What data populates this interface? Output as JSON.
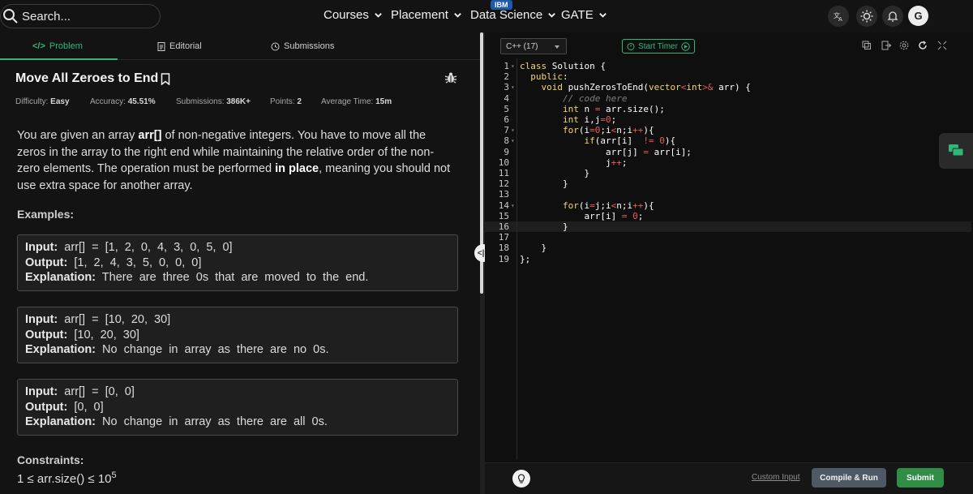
{
  "topbar": {
    "search_placeholder": "Search...",
    "nav": [
      {
        "label": "Courses"
      },
      {
        "label": "Placement"
      },
      {
        "label": "Data Science",
        "badge": "IBM"
      },
      {
        "label": "GATE"
      }
    ],
    "avatar_initial": "G"
  },
  "tabs": [
    {
      "label": "Problem",
      "icon": "code-icon",
      "active": true
    },
    {
      "label": "Editorial",
      "icon": "document-icon"
    },
    {
      "label": "Submissions",
      "icon": "clock-icon"
    }
  ],
  "problem": {
    "title": "Move All Zeroes to End",
    "difficulty_label": "Difficulty:",
    "difficulty": "Easy",
    "accuracy_label": "Accuracy:",
    "accuracy": "45.51%",
    "submissions_label": "Submissions:",
    "submissions": "386K+",
    "points_label": "Points:",
    "points": "2",
    "avg_time_label": "Average Time:",
    "avg_time": "15m",
    "desc_1": "You are given an array ",
    "desc_arr": "arr[]",
    "desc_2": " of non-negative integers. You have to move all the zeros in the array to the right end while maintaining the relative order of the non-zero elements. The operation must be performed ",
    "desc_inplace": "in place",
    "desc_3": ", meaning you should not use extra space for another array.",
    "examples_heading": "Examples:",
    "examples": [
      {
        "input_label": "Input:",
        "input": "arr[] = [1, 2, 0, 4, 3, 0, 5, 0]",
        "output_label": "Output:",
        "output": "[1, 2, 4, 3, 5, 0, 0, 0]",
        "expl_label": "Explanation:",
        "explanation": "There are three 0s that are moved to the end."
      },
      {
        "input_label": "Input:",
        "input": "arr[] = [10, 20, 30]",
        "output_label": "Output:",
        "output": "[10, 20, 30]",
        "expl_label": "Explanation:",
        "explanation": "No change in array as there are no 0s."
      },
      {
        "input_label": "Input:",
        "input": "arr[] = [0, 0]",
        "output_label": "Output:",
        "output": "[0, 0]",
        "expl_label": "Explanation:",
        "explanation": "No change in array as there are all 0s."
      }
    ],
    "constraints_heading": "Constraints:",
    "constraint_1": "1 ≤ arr.size() ≤ 10",
    "constraint_1_exp": "5"
  },
  "editor": {
    "language": "C++ (17)",
    "timer_label": "Start Timer",
    "active_line": 16,
    "lines": [
      "class Solution {",
      "  public:",
      "    void pushZerosToEnd(vector<int>& arr) {",
      "        // code here",
      "        int n = arr.size();",
      "        int i,j=0;",
      "        for(i=0;i<n;i++){",
      "            if(arr[i]  != 0){",
      "                arr[j] = arr[i];",
      "                j++;",
      "            }",
      "        }",
      "",
      "        for(i=j;i<n;i++){",
      "            arr[i] = 0;",
      "        }",
      "",
      "    }",
      "};"
    ],
    "fold_lines": [
      1,
      3,
      7,
      8,
      14
    ]
  },
  "bottom": {
    "custom_input": "Custom Input",
    "compile_label": "Compile & Run",
    "submit_label": "Submit"
  },
  "colors": {
    "accent_green": "#2fb87a",
    "submit_green": "#2f8d46",
    "keyword": "#f5d76e"
  }
}
